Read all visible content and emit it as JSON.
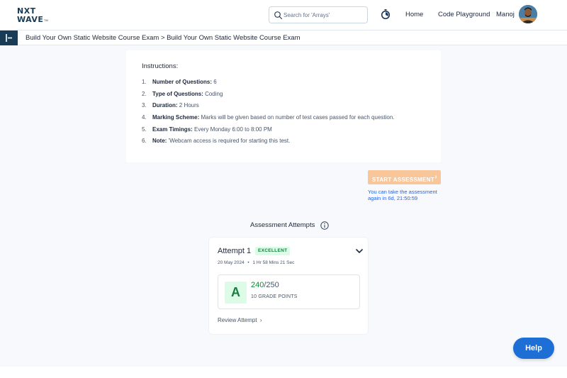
{
  "header": {
    "logo_line1": "NXT",
    "logo_line2": "WAVE",
    "logo_tm": "TM",
    "search_placeholder": "Search for 'Arrays'",
    "nav": {
      "home": "Home",
      "code_playground": "Code Playground"
    },
    "username": "Manoj"
  },
  "breadcrumb": "Build Your Own Static Website Course Exam > Build Your Own Static Website Course Exam",
  "instructions": {
    "title": "Instructions:",
    "items": [
      {
        "num": "1.",
        "label": "Number of Questions:",
        "value": " 6"
      },
      {
        "num": "2.",
        "label": "Type of Questions:",
        "value": " Coding"
      },
      {
        "num": "3.",
        "label": "Duration:",
        "value": " 2 Hours"
      },
      {
        "num": "4.",
        "label": "Marking Scheme:",
        "value": " Marks will be given based on number of test cases passed for each question."
      },
      {
        "num": "5.",
        "label": "Exam Timings:",
        "value": " Every Monday 6:00 to 8:00 PM"
      },
      {
        "num": "6.",
        "label": "Note:",
        "value": " 'Webcam access is required for starting this test."
      }
    ]
  },
  "start": {
    "label": "START ASSESSMENT",
    "retake_note": "You can take the assessment again in 6d, 21:50:59"
  },
  "attempts": {
    "title": "Assessment Attempts",
    "items": [
      {
        "label": "Attempt 1",
        "badge": "EXCELLENT",
        "date": "20 May 2024",
        "separator": "•",
        "duration": "1 Hr 58 Mins 21 Sec",
        "grade": "A",
        "score": "240",
        "total": "/250",
        "points": "10 GRADE POINTS",
        "review_label": "Review Attempt"
      }
    ]
  },
  "help_label": "Help",
  "colors": {
    "brand_dark": "#183b56",
    "accent_orange": "#f9c69a",
    "success_green": "#15803d",
    "link_blue": "#2563eb",
    "help_blue": "#1d6fd6"
  }
}
